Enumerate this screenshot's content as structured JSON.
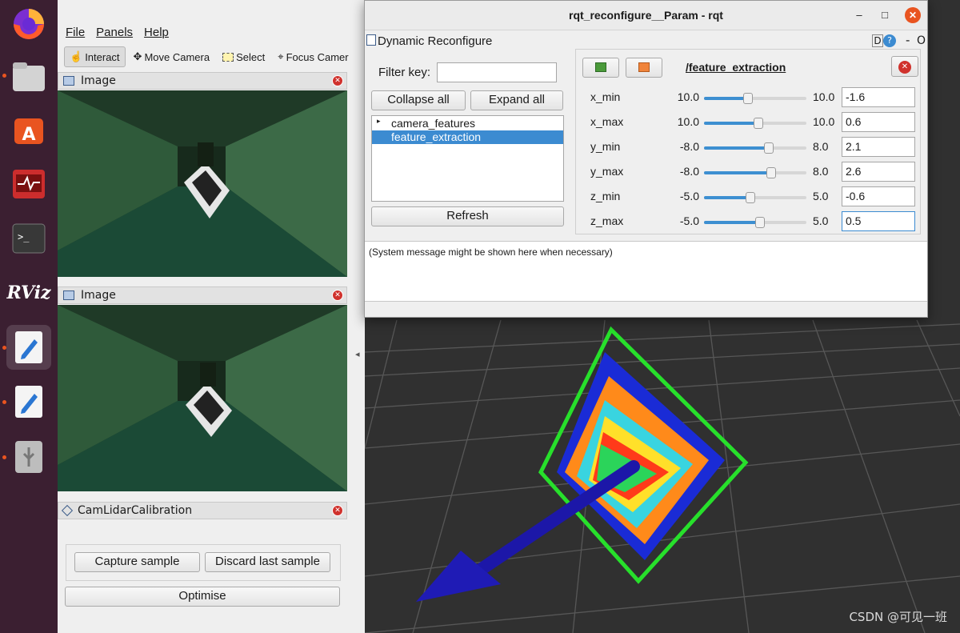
{
  "dock": {
    "items": [
      {
        "name": "firefox"
      },
      {
        "name": "files"
      },
      {
        "name": "app-center"
      },
      {
        "name": "system-monitor"
      },
      {
        "name": "terminal"
      },
      {
        "name": "rviz",
        "label": "RViz"
      },
      {
        "name": "text-editor"
      },
      {
        "name": "text-editor-2"
      },
      {
        "name": "usb-drive"
      }
    ]
  },
  "rviz": {
    "menu": [
      "File",
      "Panels",
      "Help"
    ],
    "tools": [
      "Interact",
      "Move Camera",
      "Select",
      "Focus Camer"
    ],
    "panels": {
      "image1": "Image",
      "image2": "Image",
      "calib": "CamLidarCalibration"
    },
    "buttons": {
      "capture": "Capture sample",
      "discard": "Discard last sample",
      "optimise": "Optimise"
    }
  },
  "rqt": {
    "title": "rqt_reconfigure__Param - rqt",
    "plugin_title": "Dynamic Reconfigure",
    "plugin_controls": "D",
    "plugin_help": "?",
    "plugin_min": "-",
    "plugin_close": "O",
    "filter_label": "Filter key:",
    "filter_value": "",
    "collapse_label": "Collapse all",
    "expand_label": "Expand all",
    "tree": [
      "camera_features",
      "feature_extraction"
    ],
    "selected_node": "feature_extraction",
    "refresh_label": "Refresh",
    "node_title": "/feature_extraction",
    "params": [
      {
        "name": "x_min",
        "min": "10.0",
        "max": "10.0",
        "value": "-1.6",
        "fraction": 0.43
      },
      {
        "name": "x_max",
        "min": "10.0",
        "max": "10.0",
        "value": "0.6",
        "fraction": 0.53
      },
      {
        "name": "y_min",
        "min": "-8.0",
        "max": "8.0",
        "value": "2.1",
        "fraction": 0.63
      },
      {
        "name": "y_max",
        "min": "-8.0",
        "max": "8.0",
        "value": "2.6",
        "fraction": 0.66
      },
      {
        "name": "z_min",
        "min": "-5.0",
        "max": "5.0",
        "value": "-0.6",
        "fraction": 0.45
      },
      {
        "name": "z_max",
        "min": "-5.0",
        "max": "5.0",
        "value": "0.5",
        "fraction": 0.55
      }
    ],
    "system_message": "(System message might be shown here when necessary)"
  },
  "watermark": "CSDN @可见一班",
  "colors": {
    "selection": "#3c8bd1",
    "accent": "#e95420",
    "grid": "#555555",
    "frame": "#27e02b",
    "arrow": "#1c17a8"
  }
}
